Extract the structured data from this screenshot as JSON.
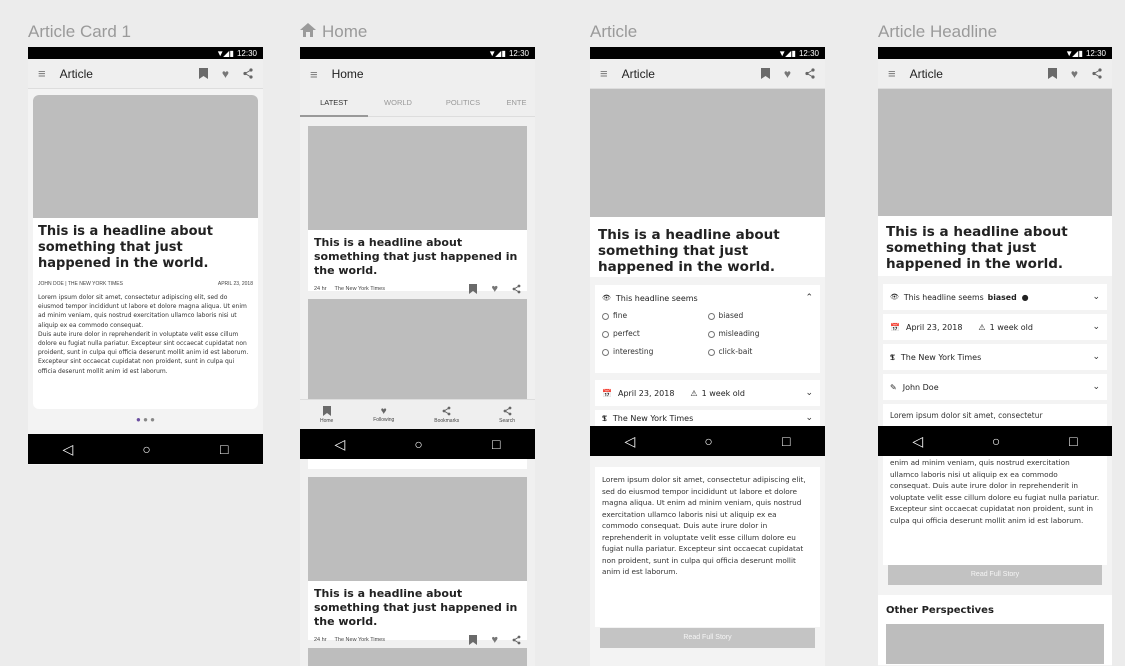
{
  "status_time": "12:30",
  "screens": {
    "s1": {
      "title": "Article Card 1"
    },
    "s2": {
      "title": "Home"
    },
    "s3": {
      "title": "Article"
    },
    "s4": {
      "title": "Article Headline"
    }
  },
  "appbar": {
    "article_title": "Article",
    "home_title": "Home"
  },
  "headline": "This is a headline about something that just happened in the world.",
  "byline": "JOHN DOE | THE NEW YORK TIMES",
  "date_caps": "APRIL 23, 2018",
  "lorem1": "Lorem ipsum dolor sit amet, consectetur adipiscing elit, sed do eiusmod tempor incididunt ut labore et dolore magna aliqua. Ut enim ad minim veniam, quis nostrud exercitation ullamco laboris nisi ut aliquip ex ea commodo consequat.",
  "lorem2": "Duis aute irure dolor in reprehenderit in voluptate velit esse cillum dolore eu fugiat nulla pariatur. Excepteur sint occaecat cupidatat non proident, sunt in culpa qui officia deserunt mollit anim id est laborum. Excepteur sint occaecat cupidatat non proident, sunt in culpa qui officia deserunt mollit anim id est laborum.",
  "lorem_full": "Lorem ipsum dolor sit amet, consectetur adipiscing elit, sed do eiusmod tempor incididunt ut labore et dolore magna aliqua. Ut enim ad minim veniam, quis nostrud exercitation ullamco laboris nisi ut aliquip ex ea commodo consequat. Duis aute irure dolor in reprehenderit in voluptate velit esse cillum dolore eu fugiat nulla pariatur. Excepteur sint occaecat cupidatat non proident, sunt in culpa qui officia deserunt mollit anim id est laborum.",
  "lorem_partial_top": "Lorem ipsum dolor sit amet, consectetur",
  "lorem_partial_bottom": "enim ad minim veniam, quis nostrud exercitation ullamco laboris nisi ut aliquip ex ea commodo consequat. Duis aute irure dolor in reprehenderit in voluptate velit esse cillum dolore eu fugiat nulla pariatur. Excepteur sint occaecat cupidatat non proident, sunt in culpa qui officia deserunt mollit anim id est laborum.",
  "home": {
    "tabs": [
      "LATEST",
      "WORLD",
      "POLITICS",
      "ENTE"
    ],
    "card_time": "24 hr",
    "card_source": "The New York Times",
    "bottom_nav": [
      "Home",
      "Following",
      "Bookmarks",
      "Search"
    ]
  },
  "rating": {
    "prompt": "This headline seems",
    "selected": "biased",
    "options": [
      "fine",
      "biased",
      "perfect",
      "misleading",
      "interesting",
      "click-bait"
    ]
  },
  "meta": {
    "date": "April 23, 2018",
    "age": "1 week old",
    "source": "The New York Times",
    "author": "John Doe"
  },
  "read_full": "Read Full Story",
  "other_perspectives": "Other Perspectives"
}
